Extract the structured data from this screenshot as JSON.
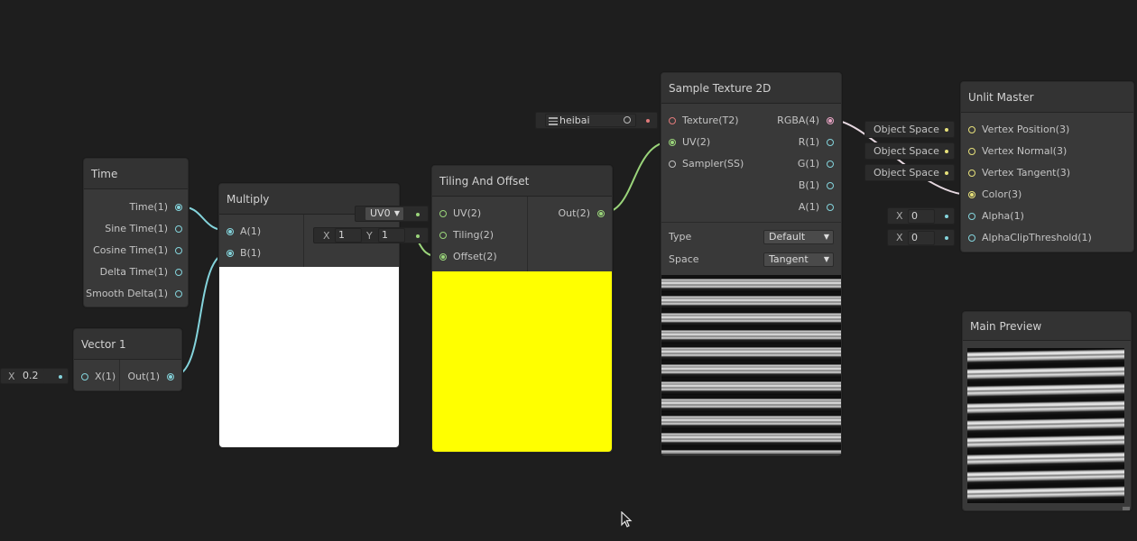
{
  "nodes": {
    "time": {
      "title": "Time",
      "outputs": [
        "Time(1)",
        "Sine Time(1)",
        "Cosine Time(1)",
        "Delta Time(1)",
        "Smooth Delta(1)"
      ]
    },
    "vector1": {
      "title": "Vector 1",
      "input": "X(1)",
      "output": "Out(1)",
      "field_label": "X",
      "field_value": "0.2"
    },
    "multiply": {
      "title": "Multiply",
      "inputs": [
        "A(1)",
        "B(1)"
      ],
      "preview_color": "#ffffff"
    },
    "tiling": {
      "title": "Tiling And Offset",
      "inputs": [
        "UV(2)",
        "Tiling(2)",
        "Offset(2)"
      ],
      "output": "Out(2)",
      "uv_dropdown": "UV0",
      "tiling_x_label": "X",
      "tiling_x": "1",
      "tiling_y_label": "Y",
      "tiling_y": "1",
      "preview_color": "#ffff00"
    },
    "texture_prop": {
      "name": "heibai"
    },
    "sample": {
      "title": "Sample Texture 2D",
      "inputs": [
        "Texture(T2)",
        "UV(2)",
        "Sampler(SS)"
      ],
      "outputs": [
        "RGBA(4)",
        "R(1)",
        "G(1)",
        "B(1)",
        "A(1)"
      ],
      "type_label": "Type",
      "type_value": "Default",
      "space_label": "Space",
      "space_value": "Tangent"
    },
    "master": {
      "title": "Unlit Master",
      "inputs": [
        "Vertex Position(3)",
        "Vertex Normal(3)",
        "Vertex Tangent(3)",
        "Color(3)",
        "Alpha(1)",
        "AlphaClipThreshold(1)"
      ],
      "space_boxes": [
        "Object Space",
        "Object Space",
        "Object Space"
      ],
      "alpha_label": "X",
      "alpha_value": "0",
      "clip_label": "X",
      "clip_value": "0"
    },
    "preview": {
      "title": "Main Preview"
    }
  },
  "colors": {
    "float_port": "#84d4dc",
    "vector2_port": "#9ad47a",
    "vector3_port": "#e6e07a",
    "vector4_port": "#e8a4c4",
    "texture_port": "#e07a7a",
    "background": "#1e1e1e"
  }
}
